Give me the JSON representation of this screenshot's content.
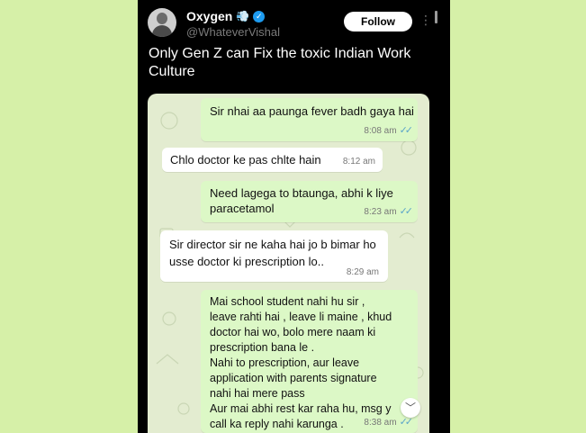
{
  "header": {
    "name": "Oxygen",
    "name_icon": "💨",
    "verified_icon": "✓",
    "handle": "@WhateverVishal",
    "follow_label": "Follow",
    "more_icon": "⋮"
  },
  "tweet": {
    "text": "Only Gen Z can Fix the toxic Indian Work Culture"
  },
  "chat": {
    "messages": [
      {
        "direction": "outgoing",
        "text": "Sir nhai aa paunga fever badh gaya hai",
        "time": "8:08 am",
        "ticks": "✓✓"
      },
      {
        "direction": "incoming",
        "text": "Chlo doctor ke pas chlte hain",
        "time": "8:12 am"
      },
      {
        "direction": "outgoing",
        "text": "Need lagega to btaunga, abhi k liye paracetamol",
        "time": "8:23 am",
        "ticks": "✓✓"
      },
      {
        "direction": "incoming",
        "text": "Sir director sir ne kaha hai jo b bimar ho usse doctor ki prescription lo..",
        "time": "8:29 am"
      },
      {
        "direction": "outgoing",
        "text": "Mai school student nahi hu sir ,\nleave rahti hai , leave li maine , khud\ndoctor hai wo, bolo mere naam ki\nprescription bana le .\nNahi to prescription, aur leave\napplication with parents signature\nnahi hai mere pass\nAur mai abhi rest kar raha hu, msg y\ncall ka reply nahi karunga .",
        "time": "8:38 am",
        "ticks": "✓✓"
      }
    ],
    "scroll_down_icon": "﹀"
  },
  "colors": {
    "background": "#d6f0a8",
    "outgoing_bubble": "#dcf8c6",
    "incoming_bubble": "#ffffff",
    "verified": "#1d9bf0",
    "read_ticks": "#5aa5c9"
  }
}
